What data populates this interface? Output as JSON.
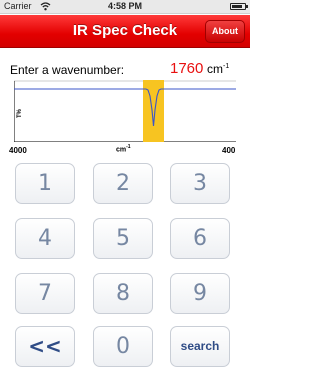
{
  "status": {
    "carrier": "Carrier",
    "time": "4:58 PM",
    "battery_level": 0.85
  },
  "nav": {
    "title": "IR Spec Check",
    "about_label": "About"
  },
  "input": {
    "prompt": "Enter a wavenumber:",
    "value": "1760",
    "unit": "cm",
    "unit_exp": "-1"
  },
  "spectrum": {
    "y_label": "T%",
    "x_left_label": "4000",
    "x_mid_label": "cm",
    "x_mid_exp": "-1",
    "x_right_label": "400",
    "colors": {
      "baseline": "#3b55c8",
      "highlight": "#f7c421"
    }
  },
  "keypad": {
    "keys": [
      "1",
      "2",
      "3",
      "4",
      "5",
      "6",
      "7",
      "8",
      "9",
      "<<",
      "0",
      "search"
    ]
  }
}
